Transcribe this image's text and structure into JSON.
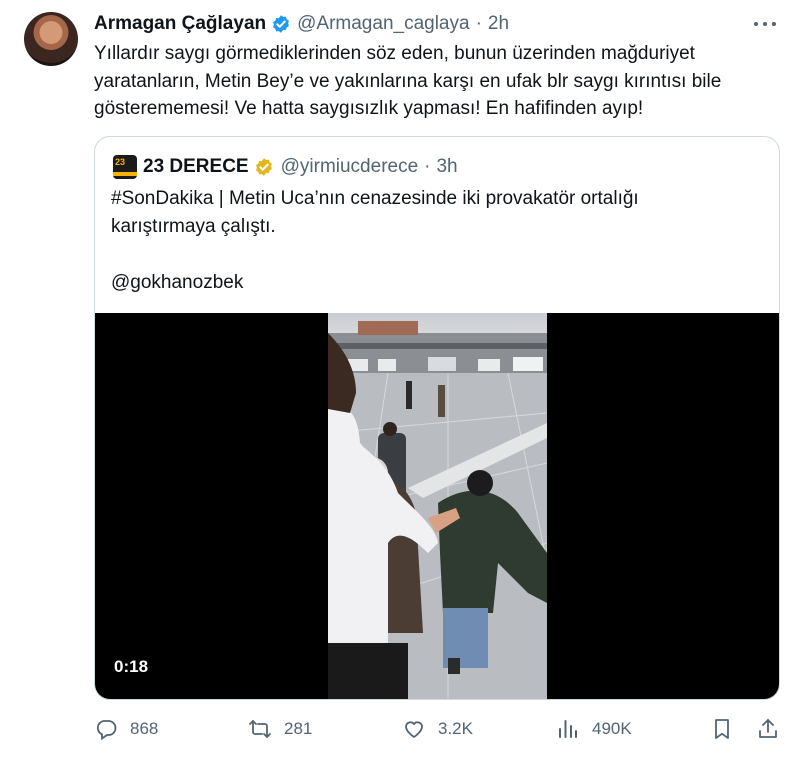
{
  "tweet": {
    "author": {
      "display_name": "Armagan Çağlayan",
      "handle": "@Armagan_caglaya",
      "time": "2h"
    },
    "text": "Yıllardır saygı görmediklerinden söz eden, bunun üzerinden mağduriyet\nyaratanların, Metin Bey’e ve yakınlarına karşı en ufak blr saygı kırıntısı bile\ngösterememesi! Ve hatta saygısızlık yapması! En hafifinden ayıp!"
  },
  "quoted_tweet": {
    "author": {
      "display_name": "23 DERECE",
      "handle": "@yirmiucderece",
      "time": "3h",
      "logo_text": "23"
    },
    "text": "#SonDakika | Metin Uca’nın cenazesinde iki provakatör ortalığı\nkarıştırmaya çalıştı.\n\n@gokhanozbek",
    "video": {
      "duration": "0:18"
    }
  },
  "actions": {
    "replies": "868",
    "reposts": "281",
    "likes": "3.2K",
    "views": "490K"
  },
  "colors": {
    "text": "#0f1419",
    "muted": "#536471",
    "verified_blue": "#1d9bf0",
    "verified_gold": "#e2b719",
    "border": "#cfd9de"
  },
  "icons": [
    "more-icon",
    "verified-badge-icon",
    "gold-verified-badge-icon",
    "reply-icon",
    "repost-icon",
    "like-icon",
    "views-icon",
    "bookmark-icon",
    "share-icon"
  ]
}
